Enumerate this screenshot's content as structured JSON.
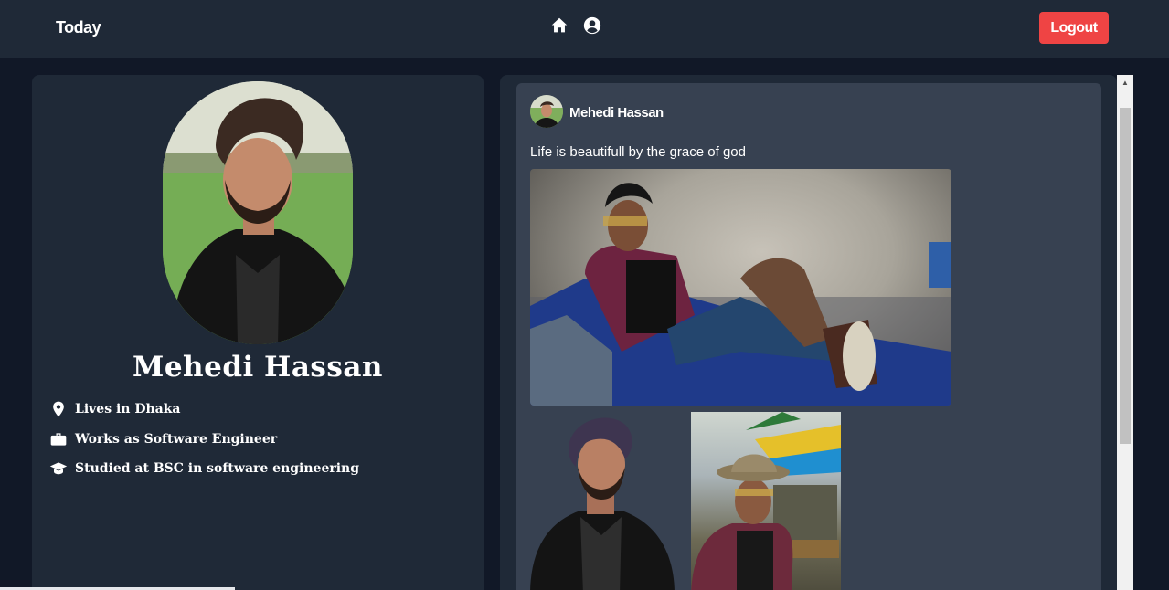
{
  "nav": {
    "brand": "Today",
    "home_icon": "home-icon",
    "profile_icon": "user-circle-icon",
    "logout_label": "Logout"
  },
  "profile": {
    "name": "Mehedi Hassan",
    "info": [
      {
        "icon": "location-pin-icon",
        "text": "Lives in Dhaka"
      },
      {
        "icon": "briefcase-icon",
        "text": "Works as Software Engineer"
      },
      {
        "icon": "graduation-cap-icon",
        "text": "Studied at BSC in software engineering"
      }
    ]
  },
  "post": {
    "author": "Mehedi Hassan",
    "text": "Life is beautifull by the grace of god"
  },
  "colors": {
    "background": "#111827",
    "panel": "#1f2937",
    "post_card": "#374151",
    "logout": "#ef4444"
  }
}
